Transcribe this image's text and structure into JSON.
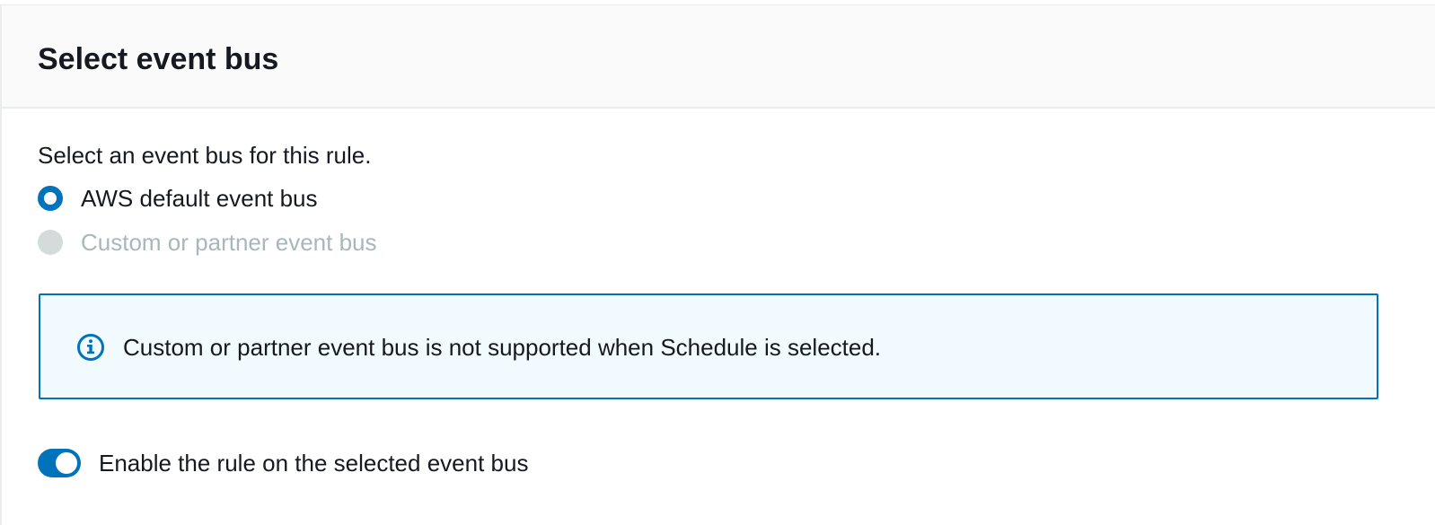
{
  "panel": {
    "title": "Select event bus",
    "description": "Select an event bus for this rule."
  },
  "event_bus_options": [
    {
      "label": "AWS default event bus",
      "selected": true,
      "disabled": false
    },
    {
      "label": "Custom or partner event bus",
      "selected": false,
      "disabled": true
    }
  ],
  "info_alert": {
    "icon": "info-icon",
    "message": "Custom or partner event bus is not supported when Schedule is selected."
  },
  "enable_toggle": {
    "label": "Enable the rule on the selected event bus",
    "checked": true
  },
  "colors": {
    "accent": "#0073bb",
    "alert_background": "#f1faff",
    "disabled": "#aab7b8",
    "header_background": "#fafafa",
    "text": "#16191f"
  }
}
